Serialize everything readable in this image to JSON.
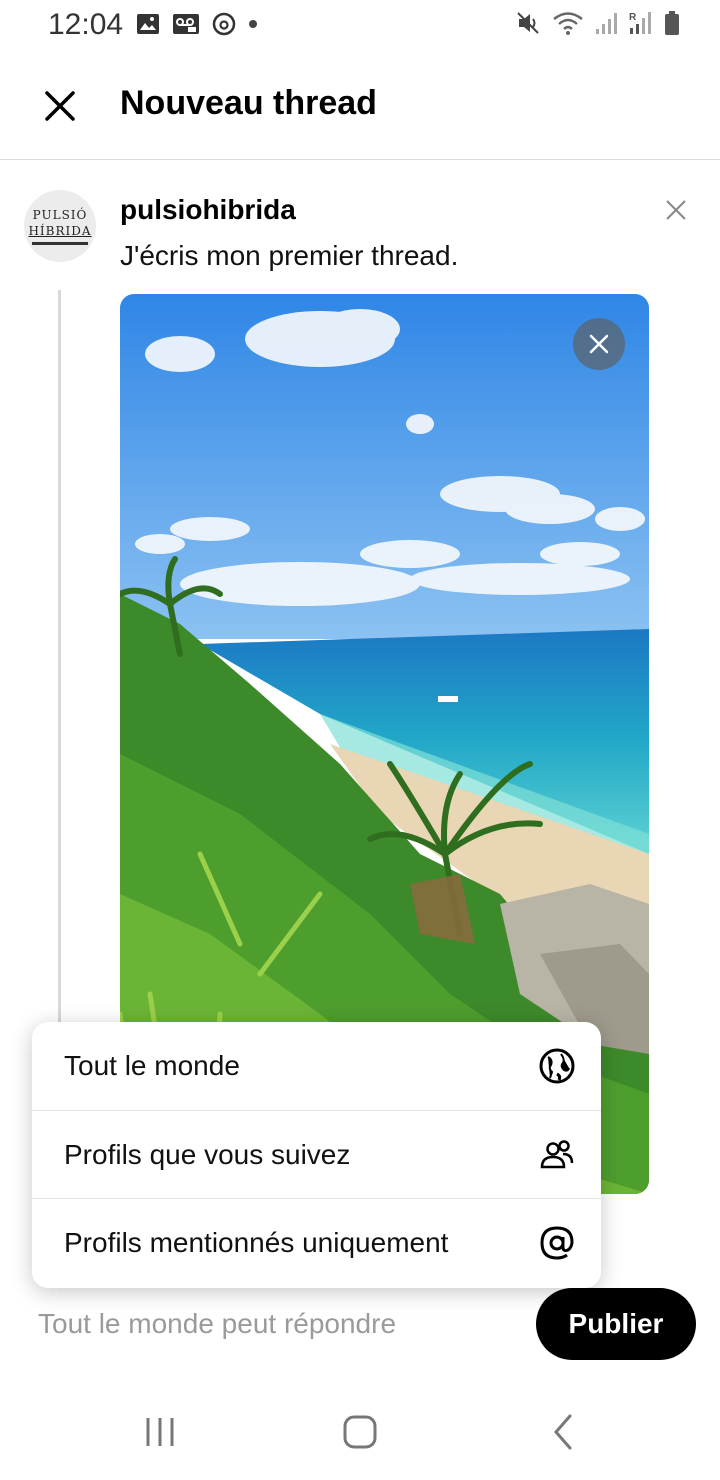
{
  "status_bar": {
    "time": "12:04",
    "left_icons": [
      "image-icon",
      "voicemail-icon",
      "threads-icon",
      "dot-icon"
    ],
    "right_icons": [
      "mute-icon",
      "wifi-icon",
      "signal-icon",
      "signal-r-icon",
      "battery-icon"
    ]
  },
  "header": {
    "title": "Nouveau thread"
  },
  "composer": {
    "avatar_text_line1": "PULSIÓ",
    "avatar_text_line2": "HÍBRIDA",
    "username": "pulsiohibrida",
    "text": "J'écris mon premier thread."
  },
  "audience_menu": {
    "items": [
      {
        "label": "Tout le monde",
        "icon": "globe-icon"
      },
      {
        "label": "Profils que vous suivez",
        "icon": "people-icon"
      },
      {
        "label": "Profils mentionnés uniquement",
        "icon": "at-icon"
      }
    ]
  },
  "footer": {
    "reply_setting": "Tout le monde peut répondre",
    "publish_label": "Publier"
  },
  "colors": {
    "accent": "#000000",
    "muted_text": "#9a9a9a",
    "divider": "#dcdcdc"
  }
}
